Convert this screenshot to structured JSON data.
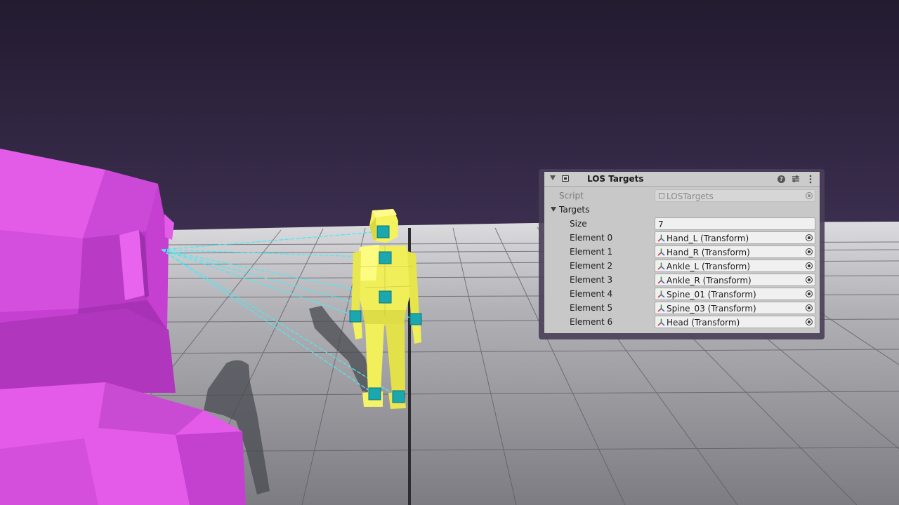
{
  "component": {
    "title": "LOS Targets",
    "script_label": "Script",
    "script_value": "LOSTargets",
    "targets_label": "Targets",
    "size_label": "Size",
    "size_value": "7",
    "elements": [
      {
        "label": "Element 0",
        "value": "Hand_L (Transform)"
      },
      {
        "label": "Element 1",
        "value": "Hand_R (Transform)"
      },
      {
        "label": "Element 2",
        "value": "Ankle_L (Transform)"
      },
      {
        "label": "Element 3",
        "value": "Ankle_R (Transform)"
      },
      {
        "label": "Element 4",
        "value": "Spine_01 (Transform)"
      },
      {
        "label": "Element 5",
        "value": "Spine_03 (Transform)"
      },
      {
        "label": "Element 6",
        "value": "Head (Transform)"
      }
    ]
  },
  "icons": {
    "fold": "triangle-down-icon",
    "component": "component-icon",
    "help": "help-icon",
    "presets": "presets-icon",
    "more": "kebab-menu-icon",
    "transform": "transform-axes-icon",
    "picker": "object-picker-icon"
  },
  "colors": {
    "sky": "#2a2038",
    "ground": "#8e8e94",
    "target_character": "#f0ef5a",
    "observer": "#d84fe0",
    "target_marker": "#1aa7b0",
    "sight_lines": "#4fe8f0",
    "panel": "#c8c8c8"
  }
}
